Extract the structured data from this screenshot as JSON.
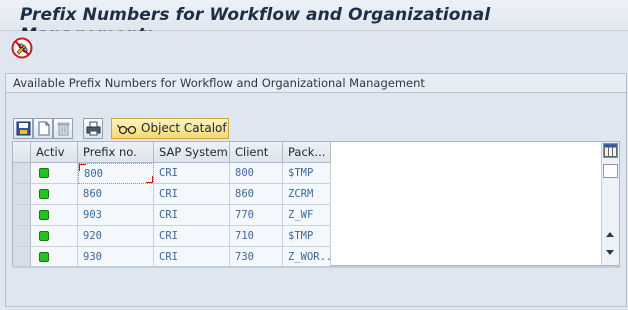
{
  "title": "Prefix Numbers for Workflow and Organizational Management:",
  "toolbar": {
    "tool_icon": "pencil-glasses-icon"
  },
  "group": {
    "title": "Available Prefix Numbers for Workflow and Organizational Management"
  },
  "alv_toolbar": {
    "icons": [
      "save-details-icon",
      "new-document-icon",
      "delete-trash-icon",
      "print-icon"
    ],
    "object_catalog_label": "Object Catalof",
    "object_catalog_icon": "glasses-icon"
  },
  "table": {
    "columns": [
      "Activ",
      "Prefix no.",
      "SAP System",
      "Client",
      "Pack..."
    ],
    "rows": [
      {
        "active": true,
        "prefix": "800",
        "system": "CRI",
        "client": "800",
        "package": "$TMP"
      },
      {
        "active": true,
        "prefix": "860",
        "system": "CRI",
        "client": "860",
        "package": "ZCRM"
      },
      {
        "active": true,
        "prefix": "903",
        "system": "CRI",
        "client": "770",
        "package": "Z_WF"
      },
      {
        "active": true,
        "prefix": "920",
        "system": "CRI",
        "client": "710",
        "package": "$TMP"
      },
      {
        "active": true,
        "prefix": "930",
        "system": "CRI",
        "client": "730",
        "package": "Z_WOR..."
      }
    ]
  },
  "colors": {
    "active_led": "#26c21f",
    "focus_corner": "#d01010",
    "object_button": "#f6d972"
  }
}
